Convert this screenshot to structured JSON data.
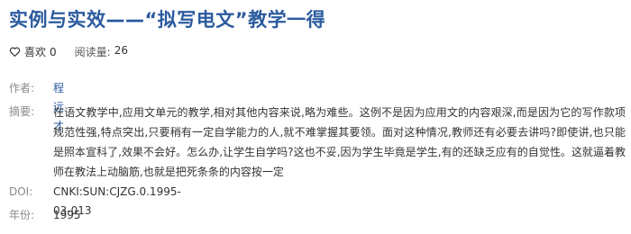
{
  "title": "实例与实效——“拟写电文”教学一得",
  "stats": {
    "like_label": "喜欢",
    "like_count": "0",
    "read_label": "阅读量:",
    "read_count": "26"
  },
  "meta": {
    "author_label": "作者:",
    "author": "程远才",
    "abstract_label": "摘要:",
    "abstract": "在语文教学中,应用文单元的教学,相对其他内容来说,略为难些。这例不是因为应用文的内容艰深,而是因为它的写作款项规范性强,特点突出,只要稍有一定自学能力的人,就不难掌握其要领。面对这种情况,教师还有必要去讲吗?即使讲,也只能是照本宣科了,效果不会好。怎么办,让学生自学吗?这也不妥,因为学生毕竟是学生,有的还缺乏应有的自觉性。这就逼着教师在教法上动脑筋,也就是把死条条的内容按一定",
    "doi_label": "DOI:",
    "doi": "CNKI:SUN:CJZG.0.1995-03-013",
    "year_label": "年份:",
    "year": "1995"
  },
  "colors": {
    "accent": "#2b5a9e",
    "label": "#8a8a8a",
    "text": "#333333"
  },
  "icons": {
    "like": "heart-outline-icon"
  }
}
